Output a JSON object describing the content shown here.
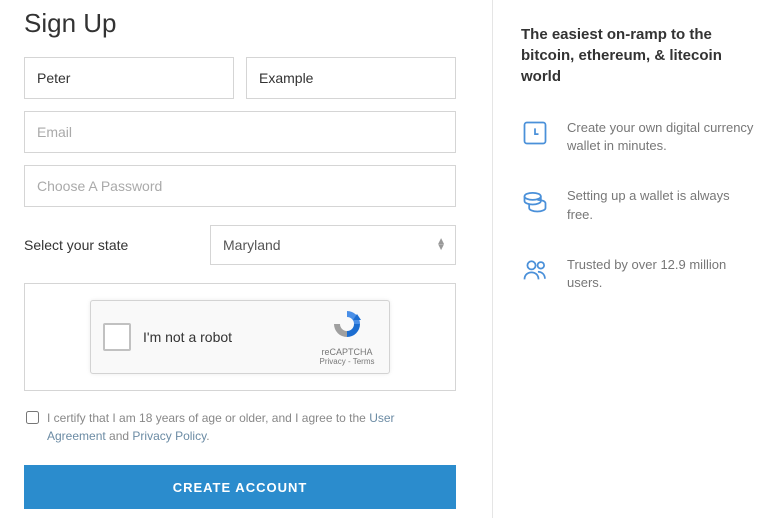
{
  "title": "Sign Up",
  "form": {
    "first_name": "Peter",
    "last_name": "Example",
    "email_placeholder": "Email",
    "password_placeholder": "Choose A Password",
    "state_label": "Select your state",
    "state_value": "Maryland"
  },
  "recaptcha": {
    "label": "I'm not a robot",
    "brand": "reCAPTCHA",
    "privacy": "Privacy",
    "terms": "Terms"
  },
  "certify": {
    "prefix": "I certify that I am 18 years of age or older, and I agree to the ",
    "user_agreement": "User Agreement",
    "and": " and ",
    "privacy_policy": "Privacy Policy",
    "suffix": "."
  },
  "submit_label": "CREATE ACCOUNT",
  "tagline": "The easiest on-ramp to the bitcoin, ethereum, & litecoin world",
  "benefits": [
    "Create your own digital currency wallet in minutes.",
    "Setting up a wallet is always free.",
    "Trusted by over 12.9 million users."
  ]
}
